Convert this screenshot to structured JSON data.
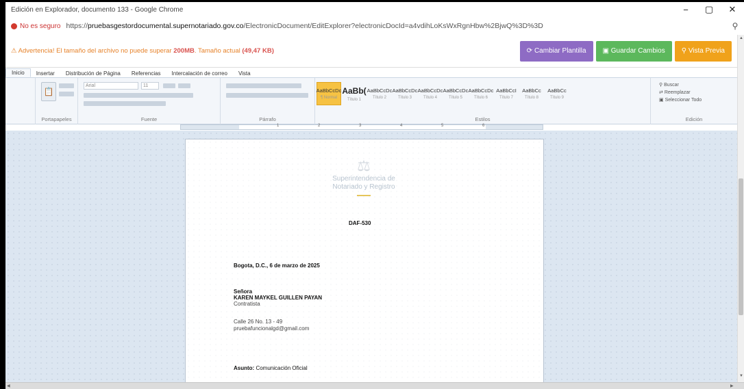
{
  "window": {
    "title": "Edición en Explorador, documento 133 - Google Chrome",
    "minimize": "−",
    "maximize": "▢",
    "close": "✕"
  },
  "address": {
    "security_label": "No es seguro",
    "url_prefix": "https://",
    "url_host": "pruebasgestordocumental.supernotariado.gov.co",
    "url_path": "/ElectronicDocument/EditExplorer?electronicDocId=a4vdihLoKsWxRgnHbw%2BjwQ%3D%3D",
    "zoom_icon": "search-icon"
  },
  "warning": {
    "prefix": "Advertencia!",
    "text": " El tamaño del archivo no puede superar ",
    "limit": "200MB",
    "current_text": ". Tamaño actual ",
    "current": "(49,47 KB)"
  },
  "actions": {
    "change_template": "Cambiar Plantilla",
    "save_changes": "Guardar Cambios",
    "preview": "Vista Previa"
  },
  "colors": {
    "purple": "#8e6bc4",
    "green": "#5cb85c",
    "orange": "#f0a21b",
    "warning": "#e6822a"
  },
  "ribbon": {
    "tabs": [
      "Inicio",
      "Insertar",
      "Distribución de Página",
      "Referencias",
      "Intercalación de correo",
      "Vista"
    ],
    "groups": {
      "clipboard": "Portapapeles",
      "font": "Fuente",
      "paragraph": "Párrafo",
      "styles": "Estilos",
      "editing": "Edición"
    },
    "font_name": "Arial",
    "font_size": "11",
    "styles": [
      {
        "preview": "AaBbCcDc",
        "label": "¶ Normal"
      },
      {
        "preview": "AaBb(",
        "label": "Título 1"
      },
      {
        "preview": "AaBbCcDc",
        "label": "Título 2"
      },
      {
        "preview": "AaBbCcDc",
        "label": "Título 3"
      },
      {
        "preview": "AaBbCcDc",
        "label": "Título 4"
      },
      {
        "preview": "AaBbCcDc",
        "label": "Título 5"
      },
      {
        "preview": "AaBbCcDc",
        "label": "Título 6"
      },
      {
        "preview": "AaBbCcI",
        "label": "Título 7"
      },
      {
        "preview": "AaBbCc",
        "label": "Título 8"
      },
      {
        "preview": "AaBbCc",
        "label": "Título 9"
      }
    ],
    "editing": {
      "find": "Buscar",
      "replace": "Reemplazar",
      "select_all": "Seleccionar Todo"
    }
  },
  "ruler_numbers": [
    "1",
    "2",
    "3",
    "4",
    "5",
    "6"
  ],
  "document": {
    "logo_line1": "Superintendencia de",
    "logo_line2": "Notariado y Registro",
    "code": "DAF-530",
    "date": "Bogota, D.C., 6 de marzo de 2025",
    "salutation": "Señora",
    "name": "KAREN MAYKEL GUILLEN PAYAN",
    "role": "Contratista",
    "address": "Calle 26 No. 13 - 49",
    "email": "pruebafuncionalgd@gmail.com",
    "subject_label": "Asunto:",
    "subject": "Comunicación Oficial"
  }
}
